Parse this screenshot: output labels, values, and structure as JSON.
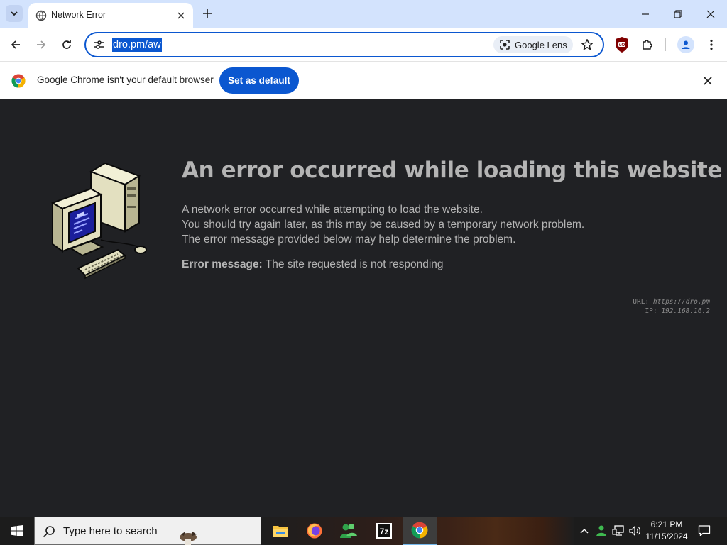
{
  "browser": {
    "tab": {
      "title": "Network Error",
      "favicon": "globe-icon"
    },
    "address_bar": {
      "url": "dro.pm/aw"
    },
    "lens_chip": {
      "label": "Google Lens",
      "icon": "google-lens-icon"
    },
    "extensions": [
      "ublock-origin-icon",
      "puzzle-extensions-icon"
    ],
    "window_controls": [
      "minimize-icon",
      "restore-icon",
      "close-icon"
    ]
  },
  "infobar": {
    "message": "Google Chrome isn't your default browser",
    "button_label": "Set as default"
  },
  "page": {
    "title": "An error occurred while loading this website",
    "body_lines": [
      "A network error occurred while attempting to load the website.",
      "You should try again later, as this may be caused by a temporary network problem.",
      "The error message provided below may help determine the problem."
    ],
    "error_label": "Error message:",
    "error_text": "The site requested is not responding",
    "meta_url_label": "URL:",
    "meta_url": "https://dro.pm",
    "meta_ip_label": "IP:",
    "meta_ip": "192.168.16.2"
  },
  "taskbar": {
    "search_placeholder": "Type here to search",
    "apps": [
      "file-explorer-icon",
      "firefox-icon",
      "messenger-icon",
      "7zip-icon",
      "chrome-icon"
    ],
    "active_app": "chrome-icon",
    "time": "6:21 PM",
    "date": "11/15/2024"
  },
  "colors": {
    "accent": "#0b57d0",
    "tabstrip": "#d3e3fd",
    "page_bg": "#202124",
    "page_text": "#b4b4b4"
  }
}
